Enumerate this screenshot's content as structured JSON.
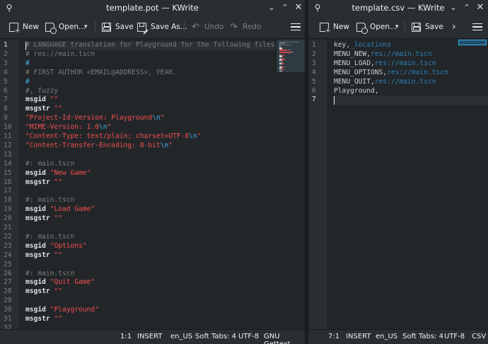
{
  "left": {
    "title": "template.pot — KWrite",
    "toolbar": {
      "new": "New",
      "open": "Open...",
      "save": "Save",
      "save_as": "Save As...",
      "undo": "Undo",
      "redo": "Redo"
    },
    "lines": [
      [
        [
          "comment",
          "# LANGUAGE translation for Playground for the following files:"
        ]
      ],
      [
        [
          "comment",
          "# res://main.tscn"
        ]
      ],
      [
        [
          "hash",
          "#"
        ]
      ],
      [
        [
          "comment",
          "# FIRST AUTHOR <EMAIL@ADDRESS>, YEAR."
        ]
      ],
      [
        [
          "hash",
          "#"
        ]
      ],
      [
        [
          "comment",
          "#, fuzzy"
        ]
      ],
      [
        [
          "kw",
          "msgid"
        ],
        [
          "text",
          " "
        ],
        [
          "str",
          "\"\""
        ]
      ],
      [
        [
          "kw",
          "msgstr"
        ],
        [
          "text",
          " "
        ],
        [
          "str",
          "\"\""
        ]
      ],
      [
        [
          "str",
          "\"Project-Id-Version: Playground"
        ],
        [
          "esc",
          "\\n"
        ],
        [
          "str",
          "\""
        ]
      ],
      [
        [
          "str",
          "\"MIME-Version: 1.0"
        ],
        [
          "esc",
          "\\n"
        ],
        [
          "str",
          "\""
        ]
      ],
      [
        [
          "str",
          "\"Content-Type: text/plain; charset=UTF-8"
        ],
        [
          "esc",
          "\\n"
        ],
        [
          "str",
          "\""
        ]
      ],
      [
        [
          "str",
          "\"Content-Transfer-Encoding: 8-bit"
        ],
        [
          "esc",
          "\\n"
        ],
        [
          "str",
          "\""
        ]
      ],
      [],
      [
        [
          "comment",
          "#: main.tscn"
        ]
      ],
      [
        [
          "kw",
          "msgid"
        ],
        [
          "text",
          " "
        ],
        [
          "str",
          "\"New Game\""
        ]
      ],
      [
        [
          "kw",
          "msgstr"
        ],
        [
          "text",
          " "
        ],
        [
          "str",
          "\"\""
        ]
      ],
      [],
      [
        [
          "comment",
          "#: main.tscn"
        ]
      ],
      [
        [
          "kw",
          "msgid"
        ],
        [
          "text",
          " "
        ],
        [
          "str",
          "\"Load Game\""
        ]
      ],
      [
        [
          "kw",
          "msgstr"
        ],
        [
          "text",
          " "
        ],
        [
          "str",
          "\"\""
        ]
      ],
      [],
      [
        [
          "comment",
          "#: main.tscn"
        ]
      ],
      [
        [
          "kw",
          "msgid"
        ],
        [
          "text",
          " "
        ],
        [
          "str",
          "\"Options\""
        ]
      ],
      [
        [
          "kw",
          "msgstr"
        ],
        [
          "text",
          " "
        ],
        [
          "str",
          "\"\""
        ]
      ],
      [],
      [
        [
          "comment",
          "#: main.tscn"
        ]
      ],
      [
        [
          "kw",
          "msgid"
        ],
        [
          "text",
          " "
        ],
        [
          "str",
          "\"Quit Game\""
        ]
      ],
      [
        [
          "kw",
          "msgstr"
        ],
        [
          "text",
          " "
        ],
        [
          "str",
          "\"\""
        ]
      ],
      [],
      [
        [
          "kw",
          "msgid"
        ],
        [
          "text",
          " "
        ],
        [
          "str",
          "\"Playground\""
        ]
      ],
      [
        [
          "kw",
          "msgstr"
        ],
        [
          "text",
          " "
        ],
        [
          "str",
          "\"\""
        ]
      ],
      []
    ],
    "current_line": 1,
    "status": {
      "cursor": "1:1",
      "mode": "INSERT",
      "lang": "en_US",
      "indent": "Soft Tabs: 4",
      "encoding": "UTF-8",
      "syntax": "GNU Gettext"
    }
  },
  "right": {
    "title": "template.csv — KWrite",
    "toolbar": {
      "new": "New",
      "open": "Open...",
      "save": "Save"
    },
    "lines": [
      [
        [
          "text",
          "key,"
        ],
        [
          "link",
          "_locations"
        ]
      ],
      [
        [
          "text",
          "MENU_NEW,"
        ],
        [
          "link",
          "res://main.tscn"
        ]
      ],
      [
        [
          "text",
          "MENU_LOAD,"
        ],
        [
          "link",
          "res://main.tscn"
        ]
      ],
      [
        [
          "text",
          "MENU_OPTIONS,"
        ],
        [
          "link",
          "res://main.tscn"
        ]
      ],
      [
        [
          "text",
          "MENU_QUIT,"
        ],
        [
          "link",
          "res://main.tscn"
        ]
      ],
      [
        [
          "text",
          "Playground,"
        ]
      ],
      []
    ],
    "current_line": 7,
    "status": {
      "cursor": "7:1",
      "mode": "INSERT",
      "lang": "en_US",
      "indent": "Soft Tabs: 4",
      "encoding": "UTF-8",
      "syntax": "CSV"
    }
  },
  "colors": {
    "background": "#232629",
    "comment": "#7a7c7d",
    "string": "#f44f4f",
    "escape": "#3daee9",
    "link": "#2980b9",
    "accent": "#3daee9"
  },
  "icons": [
    "new-document-icon",
    "open-document-icon",
    "chevron-down-icon",
    "save-icon",
    "save-as-icon",
    "undo-icon",
    "redo-icon",
    "hamburger-menu-icon",
    "pin-icon",
    "minimize-icon",
    "maximize-icon",
    "close-icon",
    "chevron-right-icon"
  ]
}
